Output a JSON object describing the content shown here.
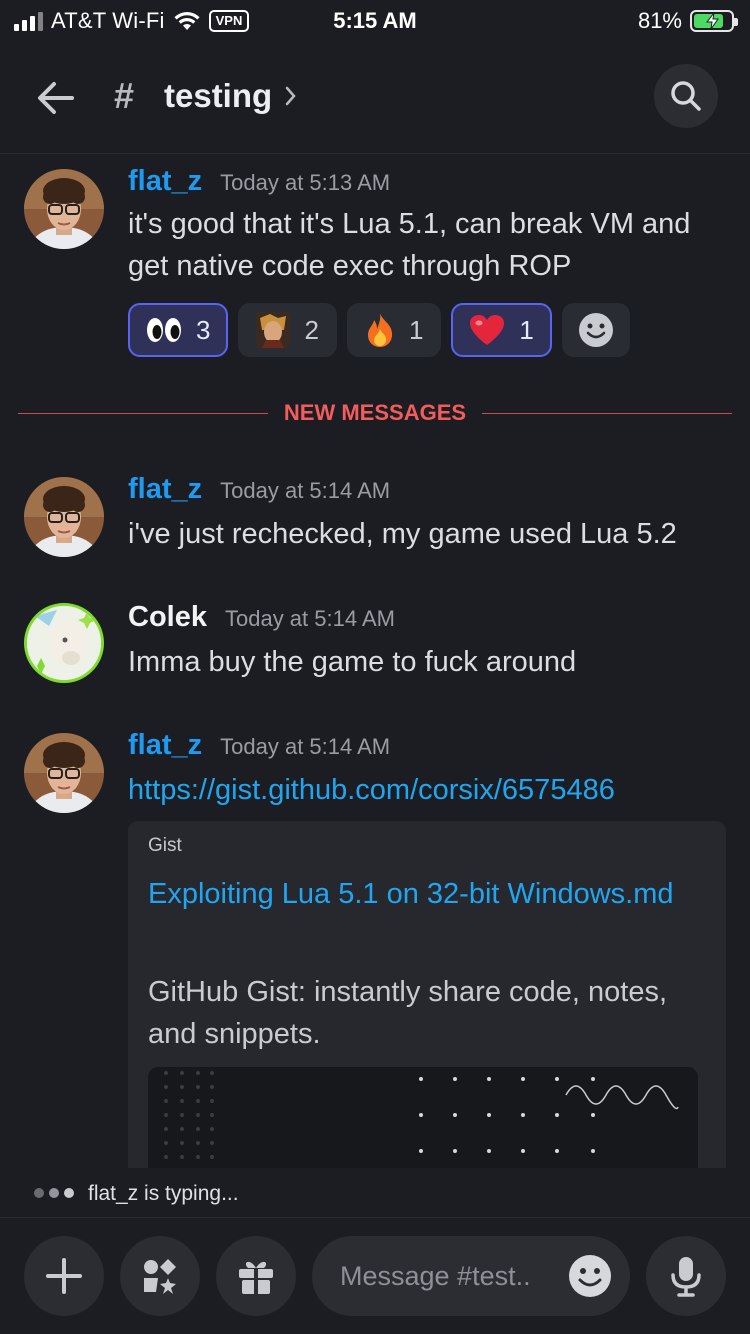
{
  "status_bar": {
    "carrier": "AT&T Wi-Fi",
    "vpn": "VPN",
    "time": "5:15 AM",
    "battery": "81%",
    "battery_level": 0.81
  },
  "header": {
    "channel": "testing",
    "hash": "#"
  },
  "messages": [
    {
      "user": "flat_z",
      "user_color": "#1e9bf0",
      "time": "Today at 5:13 AM",
      "text": "it's good that it's Lua 5.1, can break VM and get native code exec through ROP",
      "reactions": [
        {
          "emoji": "eyes",
          "count": "3",
          "active": true
        },
        {
          "emoji": "custom-avatar",
          "count": "2",
          "active": false
        },
        {
          "emoji": "fire",
          "count": "1",
          "active": false
        },
        {
          "emoji": "heart",
          "count": "1",
          "active": true
        }
      ]
    },
    {
      "user": "flat_z",
      "user_color": "#1e9bf0",
      "time": "Today at 5:14 AM",
      "text": "i've just rechecked, my game used Lua 5.2"
    },
    {
      "user": "Colek",
      "user_color": "#f2f3f5",
      "time": "Today at 5:14 AM",
      "text": "Imma buy the game to fuck around"
    },
    {
      "user": "flat_z",
      "user_color": "#1e9bf0",
      "time": "Today at 5:14 AM",
      "text": "https://gist.github.com/corsix/6575486",
      "embed": {
        "provider": "Gist",
        "title": "Exploiting Lua 5.1 on 32-bit Windows.md",
        "description": "GitHub Gist: instantly share code, notes, and snippets."
      }
    }
  ],
  "divider": {
    "label": "NEW MESSAGES"
  },
  "typing": {
    "user": "flat_z",
    "suffix": " is typing..."
  },
  "composer": {
    "placeholder": "Message #test.."
  }
}
